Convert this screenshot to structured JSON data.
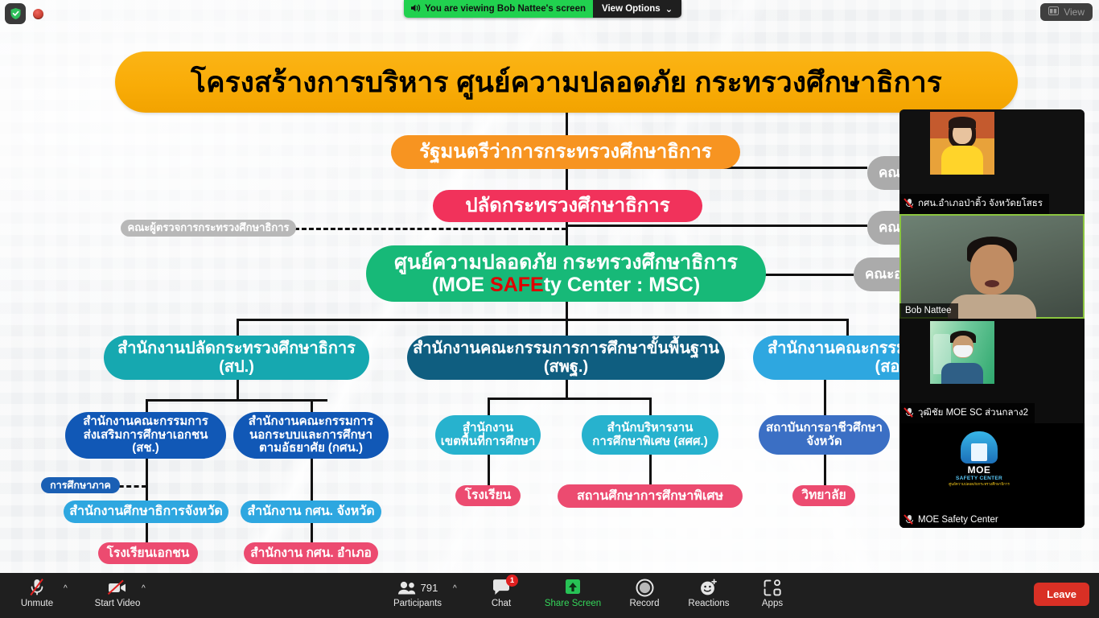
{
  "meta": {
    "app": "Zoom Meeting",
    "accent_green": "#21D14F",
    "leave_red": "#D93025"
  },
  "topbar": {
    "shield_icon": "security-shield-icon",
    "record_icon": "recording-indicator-icon",
    "speaker_icon": "speaker-icon",
    "viewing_text": "You are viewing Bob Nattee's screen",
    "view_options_label": "View Options",
    "view_options_caret": "⌄",
    "view_button_label": "View",
    "view_button_icon": "grid-view-icon"
  },
  "slide": {
    "title": "โครงสร้างการบริหาร ศูนย์ความปลอดภัย กระทรวงศึกษาธิการ",
    "nodes": {
      "minister": "รัฐมนตรีว่าการกระทรวงศึกษาธิการ",
      "permanent_secretary": "ปลัดกระทรวงศึกษาธิการ",
      "inspectors": "คณะผู้ตรวจการกระทรวงศึกษาธิการ",
      "msc_line1": "ศูนย์ความปลอดภัย กระทรวงศึกษาธิการ",
      "msc_line2_a": "(MOE ",
      "msc_line2_b": "SAFE",
      "msc_line2_c": "ty Center : MSC)",
      "right_committee_1": "คณะ",
      "right_committee_2": "คณะ",
      "right_committee_3": "คณะอ",
      "ops_line1": "สำนักงานปลัดกระทรวงศึกษาธิการ",
      "ops_line2": "(สป.)",
      "obec_line1": "สำนักงานคณะกรรมการการศึกษาขั้นพื้นฐาน",
      "obec_line2": "(สพฐ.)",
      "vec_line1": "สำนักงานคณะกรรม",
      "vec_line2": "(สอ",
      "opec_line1": "สำนักงานคณะกรรมการ",
      "opec_line2": "ส่งเสริมการศึกษาเอกชน",
      "opec_line3": "(สช.)",
      "nfe_line1": "สำนักงานคณะกรรมการ",
      "nfe_line2": "นอกระบบและการศึกษา",
      "nfe_line3": "ตามอัธยาศัย (กศน.)",
      "area_office_line1": "สำนักงาน",
      "area_office_line2": "เขตพื้นที่การศึกษา",
      "special_edu_line1": "สำนักบริหารงาน",
      "special_edu_line2": "การศึกษาพิเศษ (สศศ.)",
      "provincial_vec_line1": "สถาบันการอาชีวศึกษา",
      "provincial_vec_line2": "จังหวัด",
      "region_edu": "การศึกษาภาค",
      "provincial_edu_office": "สำนักงานศึกษาธิการจังหวัด",
      "nfe_provincial": "สำนักงาน กศน. จังหวัด",
      "private_school": "โรงเรียนเอกชน",
      "nfe_district": "สำนักงาน กศน. อำเภอ",
      "school": "โรงเรียน",
      "special_school": "สถานศึกษาการศึกษาพิเศษ",
      "college": "วิทยาลัย"
    }
  },
  "participants": [
    {
      "name": "กศน.อำเภอป่าติ้ว จังหวัดยโสธร",
      "muted": true,
      "active_speaker": false
    },
    {
      "name": "Bob Nattee",
      "muted": false,
      "active_speaker": true
    },
    {
      "name": "วุฒิชัย MOE SC ส่วนกลาง2",
      "muted": true,
      "active_speaker": false
    },
    {
      "name": "MOE Safety Center",
      "muted": true,
      "active_speaker": false
    }
  ],
  "moe_logo": {
    "title": "MOE",
    "subtitle": "SAFETY CENTER",
    "thai": "ศูนย์ความปลอดภัยกระทรวงศึกษาธิการ"
  },
  "toolbar": {
    "mute": {
      "label": "Unmute",
      "icon": "microphone-muted-icon",
      "caret": "^"
    },
    "video": {
      "label": "Start Video",
      "icon": "camera-off-icon",
      "caret": "^"
    },
    "participants": {
      "label": "Participants",
      "count": "791",
      "icon": "participants-icon",
      "caret": "^"
    },
    "chat": {
      "label": "Chat",
      "icon": "chat-icon",
      "badge": "1"
    },
    "share": {
      "label": "Share Screen",
      "icon": "share-screen-icon"
    },
    "record": {
      "label": "Record",
      "icon": "record-icon"
    },
    "reactions": {
      "label": "Reactions",
      "icon": "reactions-icon"
    },
    "apps": {
      "label": "Apps",
      "icon": "apps-icon"
    },
    "leave": {
      "label": "Leave"
    }
  }
}
